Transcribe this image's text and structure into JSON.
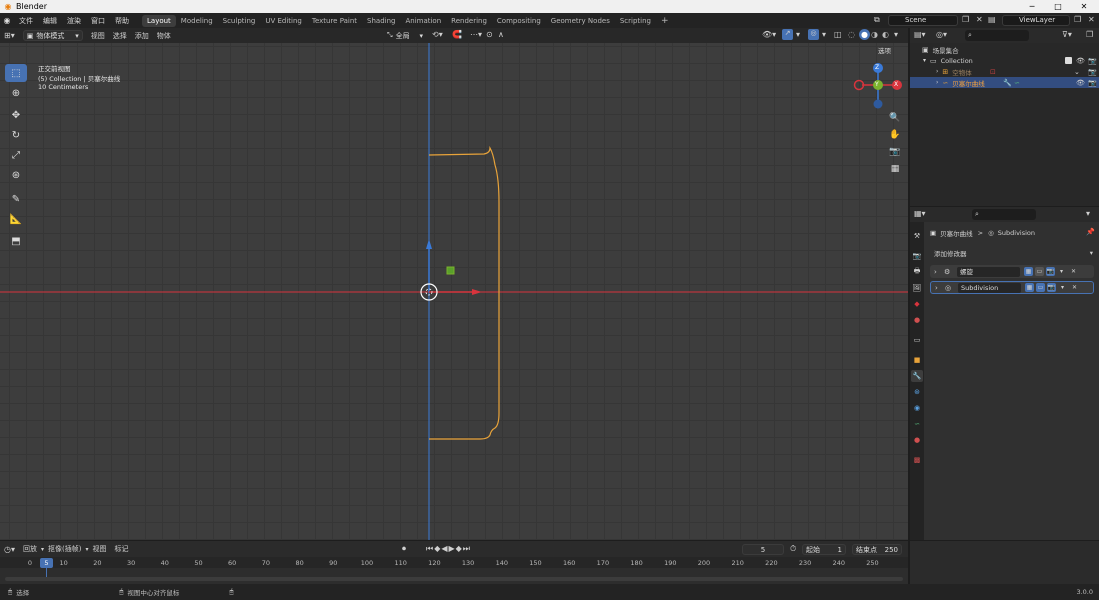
{
  "window": {
    "title": "Blender",
    "min": "─",
    "max": "□",
    "close": "✕"
  },
  "menu": [
    "文件",
    "编辑",
    "渲染",
    "窗口",
    "帮助"
  ],
  "workspaces": [
    "Layout",
    "Modeling",
    "Sculpting",
    "UV Editing",
    "Texture Paint",
    "Shading",
    "Animation",
    "Rendering",
    "Compositing",
    "Geometry Nodes",
    "Scripting"
  ],
  "active_workspace": "Layout",
  "scene": {
    "name": "Scene",
    "view_layer": "ViewLayer"
  },
  "viewport_header": {
    "mode": "物体模式",
    "menus": [
      "视图",
      "选择",
      "添加",
      "物体"
    ],
    "transform_orientation": "全局",
    "options_label": "选项"
  },
  "viewport_info": {
    "view_name": "正交前视图",
    "collection_line": "(5) Collection | 贝塞尔曲线",
    "scale": "10 Centimeters"
  },
  "gizmo": {
    "z": "Z",
    "y": "Y",
    "x": "X"
  },
  "outliner": {
    "search_placeholder": "",
    "root": "场景集合",
    "collection": "Collection",
    "items": [
      "空物体",
      "贝塞尔曲线"
    ]
  },
  "properties": {
    "breadcrumb_object": "贝塞尔曲线",
    "breadcrumb_sep": ">",
    "breadcrumb_modifier": "Subdivision",
    "add_modifier": "添加修改器",
    "modifiers": [
      {
        "name": "螺旋",
        "icon": "screw-icon"
      },
      {
        "name": "Subdivision",
        "icon": "subdivision-icon"
      }
    ]
  },
  "timeline": {
    "menus": [
      "回放",
      "抠像(插帧)",
      "视图",
      "标记"
    ],
    "current_frame": "5",
    "start_label": "起始",
    "start": "1",
    "end_label": "结束点",
    "end": "250",
    "ticks": [
      "0",
      "10",
      "20",
      "30",
      "40",
      "50",
      "60",
      "70",
      "80",
      "90",
      "100",
      "110",
      "120",
      "130",
      "140",
      "150",
      "160",
      "170",
      "180",
      "190",
      "200",
      "210",
      "220",
      "230",
      "240",
      "250"
    ]
  },
  "status": {
    "select": "选择",
    "center": "视图中心对齐鼠标",
    "version": "3.0.0"
  },
  "colors": {
    "accent": "#4772b3",
    "curve": "#e8a33a",
    "x_axis": "#d8343d",
    "y_axis": "#7bb22d",
    "z_axis": "#3a7ad8"
  }
}
